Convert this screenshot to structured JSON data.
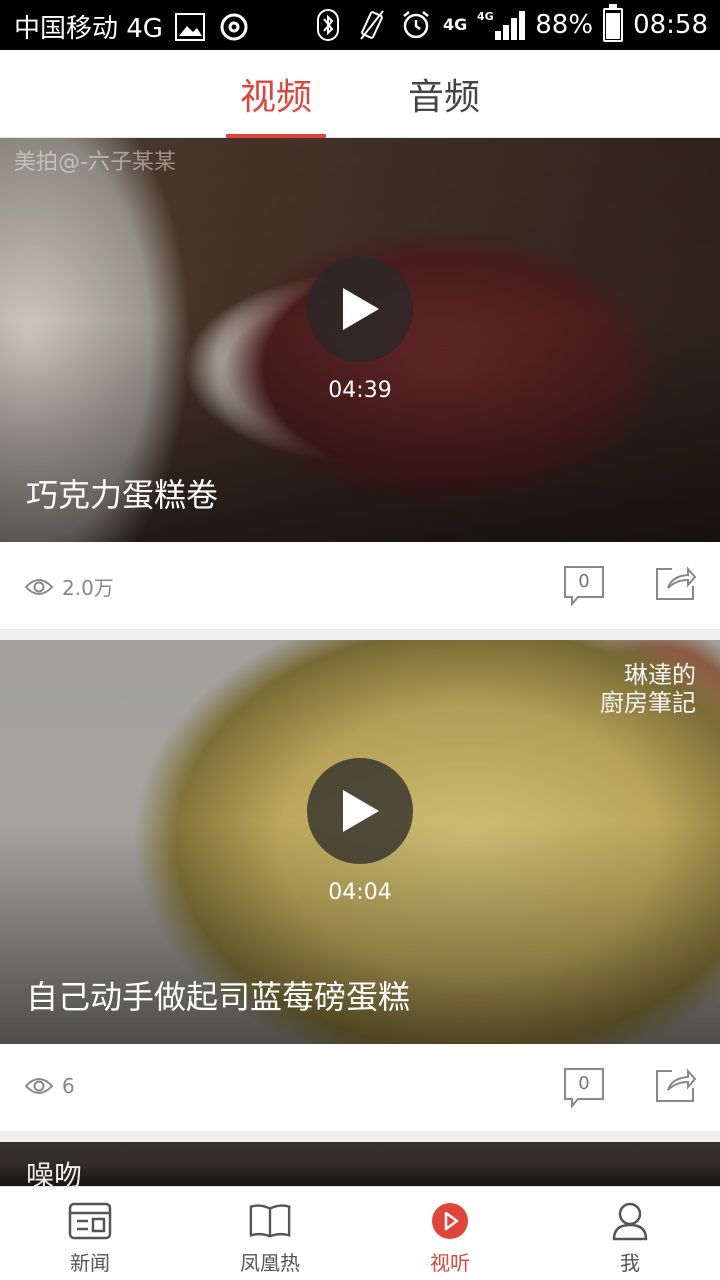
{
  "status_bar": {
    "carrier": "中国移动 4G",
    "network_left": "4G",
    "network_right": "4G",
    "battery": "88%",
    "battery_level": 0.88,
    "time": "08:58"
  },
  "tabs": [
    {
      "label": "视频",
      "active": true
    },
    {
      "label": "音频",
      "active": false
    }
  ],
  "feed": [
    {
      "watermark": "美拍@-六子某某",
      "duration": "04:39",
      "title": "巧克力蛋糕卷",
      "views": "2.0万",
      "comments": "0"
    },
    {
      "watermark": "琳達的\n廚房筆記",
      "duration": "04:04",
      "title": "自己动手做起司蓝莓磅蛋糕",
      "views": "6",
      "comments": "0"
    },
    {
      "watermark": "噪吻"
    }
  ],
  "bottom_nav": [
    {
      "label": "新闻",
      "icon": "news-icon",
      "active": false
    },
    {
      "label": "凤凰热",
      "icon": "book-icon",
      "active": false
    },
    {
      "label": "视听",
      "icon": "play-circle-icon",
      "active": true
    },
    {
      "label": "我",
      "icon": "user-icon",
      "active": false
    }
  ],
  "colors": {
    "accent": "#e0453a",
    "text_muted": "#888888"
  }
}
